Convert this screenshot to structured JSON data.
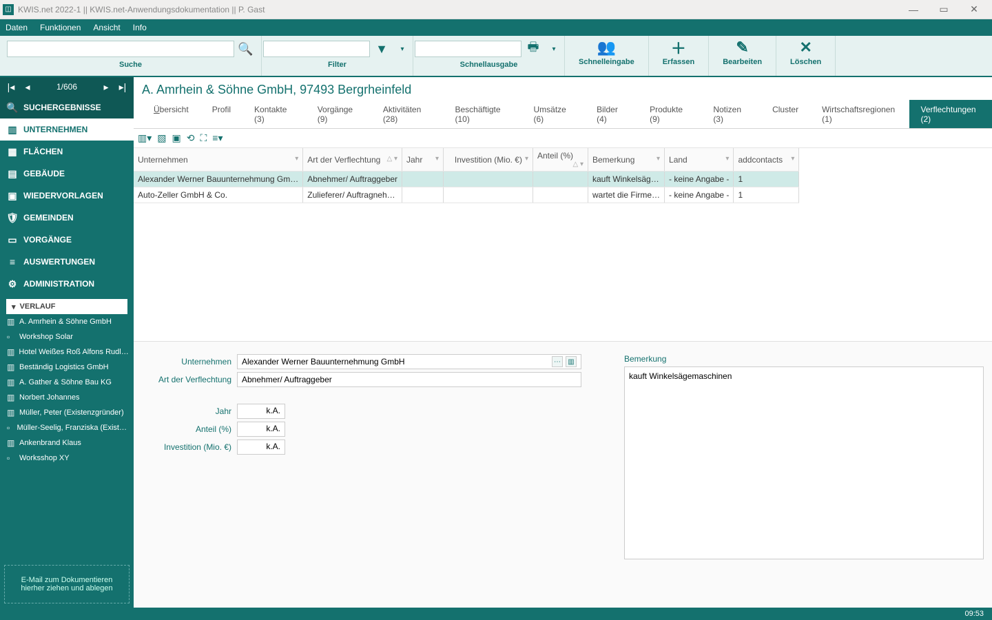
{
  "title": "KWIS.net 2022-1 || KWIS.net-Anwendungsdokumentation || P. Gast",
  "menu": [
    "Daten",
    "Funktionen",
    "Ansicht",
    "Info"
  ],
  "toolbar": {
    "suche": "Suche",
    "filter": "Filter",
    "schnell_out": "Schnellausgabe",
    "schnell_in": "Schnelleingabe",
    "erfassen": "Erfassen",
    "bearbeiten": "Bearbeiten",
    "loeschen": "Löschen"
  },
  "nav": {
    "counter": "1/606"
  },
  "sidebar": {
    "items": [
      "SUCHERGEBNISSE",
      "UNTERNEHMEN",
      "FLÄCHEN",
      "GEBÄUDE",
      "WIEDERVORLAGEN",
      "GEMEINDEN",
      "VORGÄNGE",
      "AUSWERTUNGEN",
      "ADMINISTRATION"
    ],
    "verlauf_head": "VERLAUF",
    "verlauf": [
      "A. Amrhein & Söhne GmbH",
      "Workshop Solar",
      "Hotel Weißes Roß Alfons Rudl…",
      "Beständig Logistics GmbH",
      "A. Gather & Söhne Bau KG",
      "Norbert Johannes",
      "Müller, Peter (Existenzgründer)",
      "Müller-Seelig, Franziska (Exist…",
      "Ankenbrand Klaus",
      "Worksshop XY"
    ],
    "drop1": "E-Mail  zum Dokumentieren",
    "drop2": "hierher ziehen und ablegen"
  },
  "record": {
    "title": "A. Amrhein & Söhne GmbH, 97493 Bergrheinfeld"
  },
  "tabs": [
    "Übersicht",
    "Profil",
    "Kontakte (3)",
    "Vorgänge (9)",
    "Aktivitäten (28)",
    "Beschäftigte (10)",
    "Umsätze (6)",
    "Bilder (4)",
    "Produkte (9)",
    "Notizen (3)",
    "Cluster",
    "Wirtschaftsregionen (1)",
    "Verflechtungen (2)"
  ],
  "cols": {
    "unternehmen": "Unternehmen",
    "art": "Art der Verflechtung",
    "jahr": "Jahr",
    "inv": "Investition (Mio. €)",
    "anteil": "Anteil (%)",
    "bem": "Bemerkung",
    "land": "Land",
    "add": "addcontacts"
  },
  "rows": [
    {
      "u": "Alexander Werner Bauunternehmung Gm…",
      "a": "Abnehmer/ Auftraggeber",
      "j": "",
      "inv": "",
      "ant": "",
      "b": "kauft Winkelsäg…",
      "l": "- keine Angabe -",
      "ad": "1"
    },
    {
      "u": "Auto-Zeller GmbH & Co.",
      "a": "Zulieferer/ Auftragneh…",
      "j": "",
      "inv": "",
      "ant": "",
      "b": "wartet die Firme…",
      "l": "- keine Angabe -",
      "ad": "1"
    }
  ],
  "detail": {
    "labels": {
      "unt": "Unternehmen",
      "art": "Art der Verflechtung",
      "jahr": "Jahr",
      "ant": "Anteil (%)",
      "inv": "Investition (Mio. €)",
      "bem": "Bemerkung",
      "ka": "k.A."
    },
    "unt": "Alexander Werner Bauunternehmung GmbH",
    "art": "Abnehmer/ Auftraggeber",
    "bem": "kauft Winkelsägemaschinen"
  },
  "status": {
    "time": "09:53"
  }
}
